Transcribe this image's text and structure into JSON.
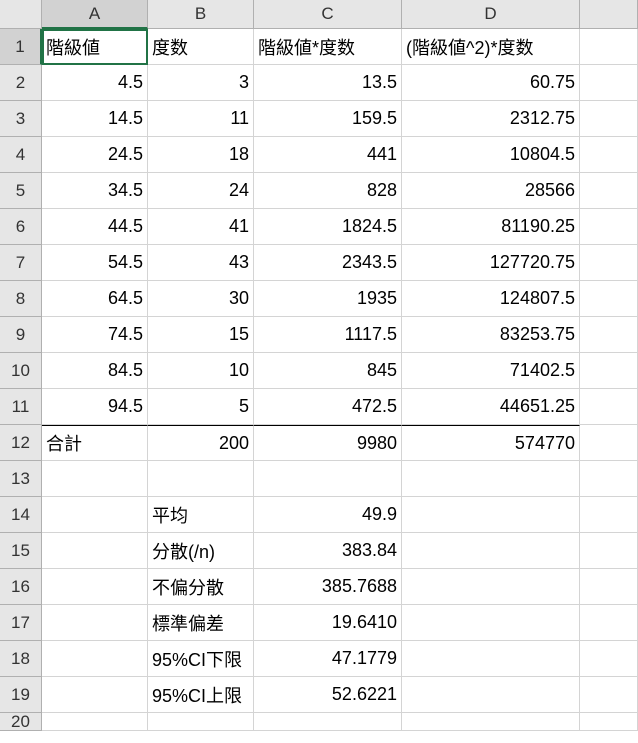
{
  "columns": [
    "A",
    "B",
    "C",
    "D"
  ],
  "rowCount": 20,
  "activeCell": {
    "row": 1,
    "col": "A"
  },
  "headers": {
    "A": "階級値",
    "B": "度数",
    "C": "階級値*度数",
    "D": " (階級値^2)*度数"
  },
  "data": [
    {
      "A": "4.5",
      "B": "3",
      "C": "13.5",
      "D": "60.75"
    },
    {
      "A": "14.5",
      "B": "11",
      "C": "159.5",
      "D": "2312.75"
    },
    {
      "A": "24.5",
      "B": "18",
      "C": "441",
      "D": "10804.5"
    },
    {
      "A": "34.5",
      "B": "24",
      "C": "828",
      "D": "28566"
    },
    {
      "A": "44.5",
      "B": "41",
      "C": "1824.5",
      "D": "81190.25"
    },
    {
      "A": "54.5",
      "B": "43",
      "C": "2343.5",
      "D": "127720.75"
    },
    {
      "A": "64.5",
      "B": "30",
      "C": "1935",
      "D": "124807.5"
    },
    {
      "A": "74.5",
      "B": "15",
      "C": "1117.5",
      "D": "83253.75"
    },
    {
      "A": "84.5",
      "B": "10",
      "C": "845",
      "D": "71402.5"
    },
    {
      "A": "94.5",
      "B": "5",
      "C": "472.5",
      "D": "44651.25"
    }
  ],
  "totals": {
    "label": "合計",
    "B": "200",
    "C": "9980",
    "D": "574770"
  },
  "stats": [
    {
      "label": "平均",
      "value": "49.9"
    },
    {
      "label": "分散(/n)",
      "value": "383.84"
    },
    {
      "label": "不偏分散",
      "value": "385.7688"
    },
    {
      "label": "標準偏差",
      "value": "19.6410"
    },
    {
      "label": "95%CI下限",
      "value": "47.1779"
    },
    {
      "label": "95%CI上限",
      "value": "52.6221"
    }
  ],
  "chart_data": {
    "type": "table",
    "title": "Frequency Distribution with Statistics",
    "columns": [
      "階級値",
      "度数",
      "階級値*度数",
      "(階級値^2)*度数"
    ],
    "rows": [
      [
        4.5,
        3,
        13.5,
        60.75
      ],
      [
        14.5,
        11,
        159.5,
        2312.75
      ],
      [
        24.5,
        18,
        441,
        10804.5
      ],
      [
        34.5,
        24,
        828,
        28566
      ],
      [
        44.5,
        41,
        1824.5,
        81190.25
      ],
      [
        54.5,
        43,
        2343.5,
        127720.75
      ],
      [
        64.5,
        30,
        1935,
        124807.5
      ],
      [
        74.5,
        15,
        1117.5,
        83253.75
      ],
      [
        84.5,
        10,
        845,
        71402.5
      ],
      [
        94.5,
        5,
        472.5,
        44651.25
      ]
    ],
    "totals": [
      200,
      9980,
      574770
    ],
    "statistics": {
      "平均": 49.9,
      "分散(/n)": 383.84,
      "不偏分散": 385.7688,
      "標準偏差": 19.641,
      "95%CI下限": 47.1779,
      "95%CI上限": 52.6221
    }
  }
}
